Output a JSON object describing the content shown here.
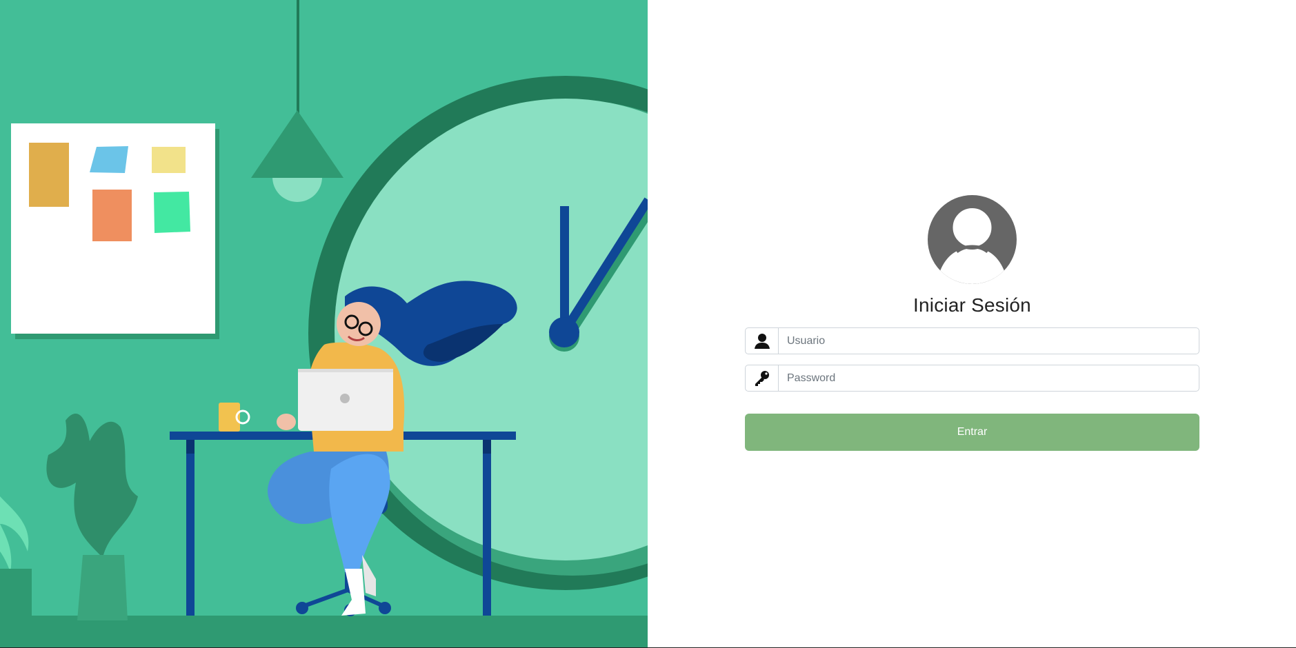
{
  "login": {
    "title": "Iniciar Sesión",
    "username_placeholder": "Usuario",
    "password_placeholder": "Password",
    "submit_label": "Entrar"
  },
  "icons": {
    "avatar": "user-avatar-icon",
    "username": "user-icon",
    "password": "key-icon"
  },
  "colors": {
    "illustration_bg": "#43be97",
    "submit_button": "#80b67c",
    "avatar_bg": "#666666",
    "text": "#222222"
  }
}
